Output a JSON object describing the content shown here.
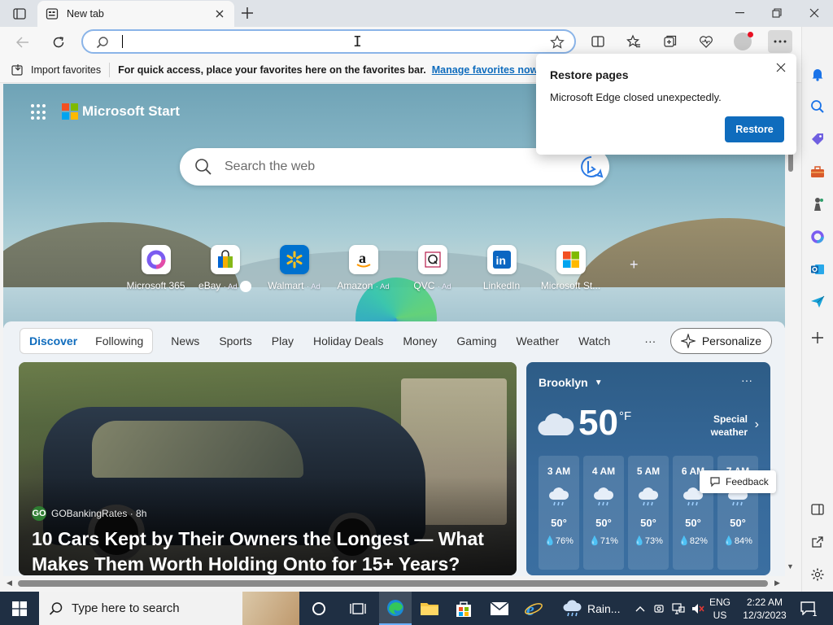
{
  "browser": {
    "tab": {
      "title": "New tab"
    },
    "address": {
      "value": "",
      "placeholder": ""
    },
    "favorites_bar": {
      "import_label": "Import favorites",
      "tip": "For quick access, place your favorites here on the favorites bar.",
      "manage_link": "Manage favorites now"
    }
  },
  "restore_popup": {
    "title": "Restore pages",
    "message": "Microsoft Edge closed unexpectedly.",
    "button": "Restore"
  },
  "newtab": {
    "brand": "Microsoft Start",
    "search_placeholder": "Search the web",
    "quick_links": [
      {
        "label": "Microsoft 365",
        "ad": ""
      },
      {
        "label": "eBay",
        "ad": "· Ad"
      },
      {
        "label": "Walmart",
        "ad": "· Ad"
      },
      {
        "label": "Amazon",
        "ad": "· Ad"
      },
      {
        "label": "QVC",
        "ad": "· Ad"
      },
      {
        "label": "LinkedIn",
        "ad": ""
      },
      {
        "label": "Microsoft St...",
        "ad": ""
      }
    ],
    "feed": {
      "segments": [
        "Discover",
        "Following"
      ],
      "tabs": [
        "News",
        "Sports",
        "Play",
        "Holiday Deals",
        "Money",
        "Gaming",
        "Weather",
        "Watch"
      ],
      "more": "···",
      "personalize": "Personalize"
    },
    "article": {
      "source": "GOBankingRates · 8h",
      "source_badge": "GO",
      "headline": "10 Cars Kept by Their Owners the Longest — What Makes Them Worth Holding Onto for 15+ Years?"
    },
    "weather": {
      "city": "Brooklyn",
      "temp": "50",
      "unit": "°F",
      "special_line1": "Special",
      "special_line2": "weather",
      "hours": [
        {
          "time": "3 AM",
          "temp": "50°",
          "precip": "76%"
        },
        {
          "time": "4 AM",
          "temp": "50°",
          "precip": "71%"
        },
        {
          "time": "5 AM",
          "temp": "50°",
          "precip": "73%"
        },
        {
          "time": "6 AM",
          "temp": "50°",
          "precip": "82%"
        },
        {
          "time": "7 AM",
          "temp": "50°",
          "precip": "84%"
        }
      ]
    },
    "feedback": "Feedback"
  },
  "taskbar": {
    "search_placeholder": "Type here to search",
    "weather_label": "Rain...",
    "lang_1": "ENG",
    "lang_2": "US",
    "time": "2:22 AM",
    "date": "12/3/2023",
    "notifications": "1"
  },
  "colors": {
    "accent": "#0f6cbd",
    "taskbar": "#1f2f43",
    "weather_card": "#37699a"
  }
}
